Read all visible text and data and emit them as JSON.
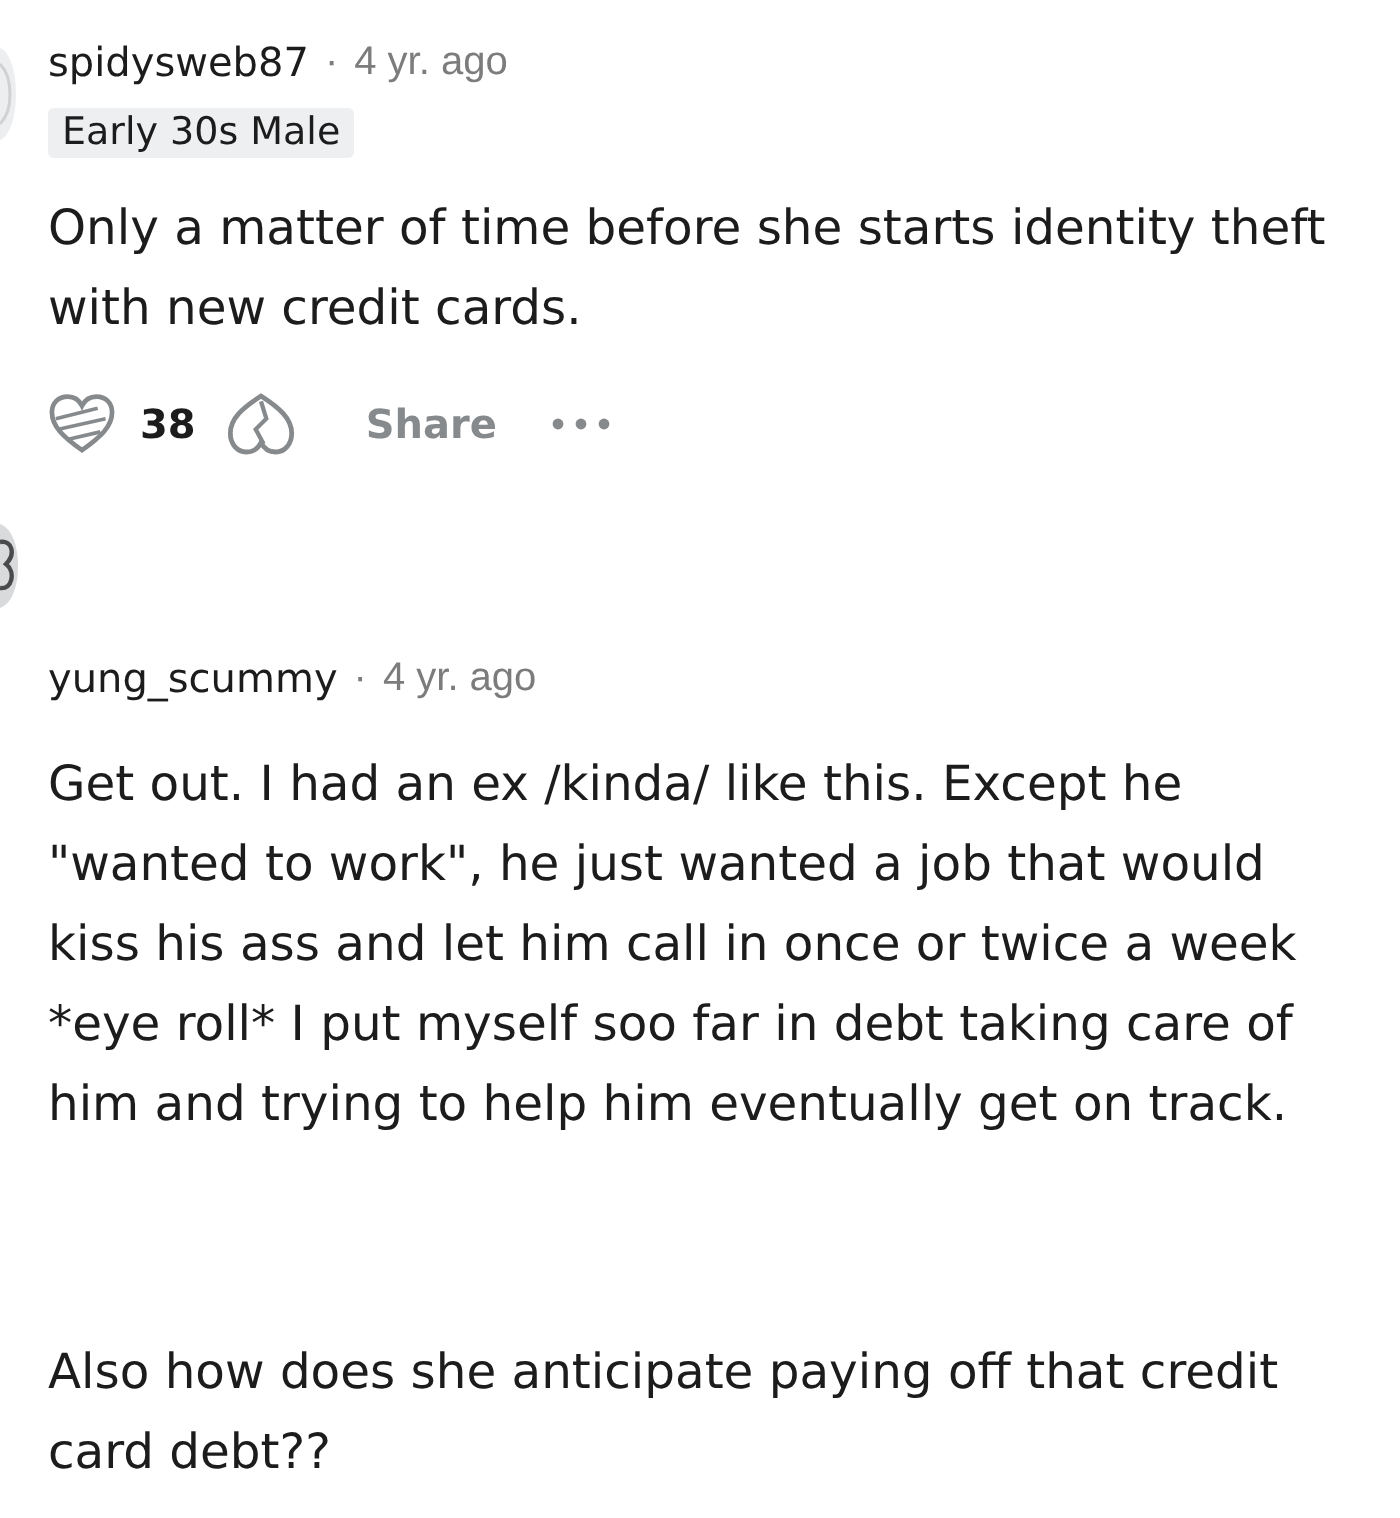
{
  "comments": [
    {
      "username": "spidysweb87",
      "separator": "·",
      "age": "4 yr. ago",
      "flair": "Early 30s Male",
      "paragraphs": [
        "Only a matter of time before she starts identity theft with new credit cards."
      ],
      "actions": {
        "score": "38",
        "share": "Share"
      }
    },
    {
      "username": "yung_scummy",
      "separator": "·",
      "age": "4 yr. ago",
      "paragraphs": [
        "Get out. I had an ex /kinda/ like this. Except he \"wanted to work\", he just wanted a job that would kiss his ass and let him call in once or twice a week *eye roll* I put myself soo far in debt taking care of him and trying to help him eventually get on track.",
        "Also how does she anticipate paying off that credit card debt??"
      ]
    }
  ]
}
